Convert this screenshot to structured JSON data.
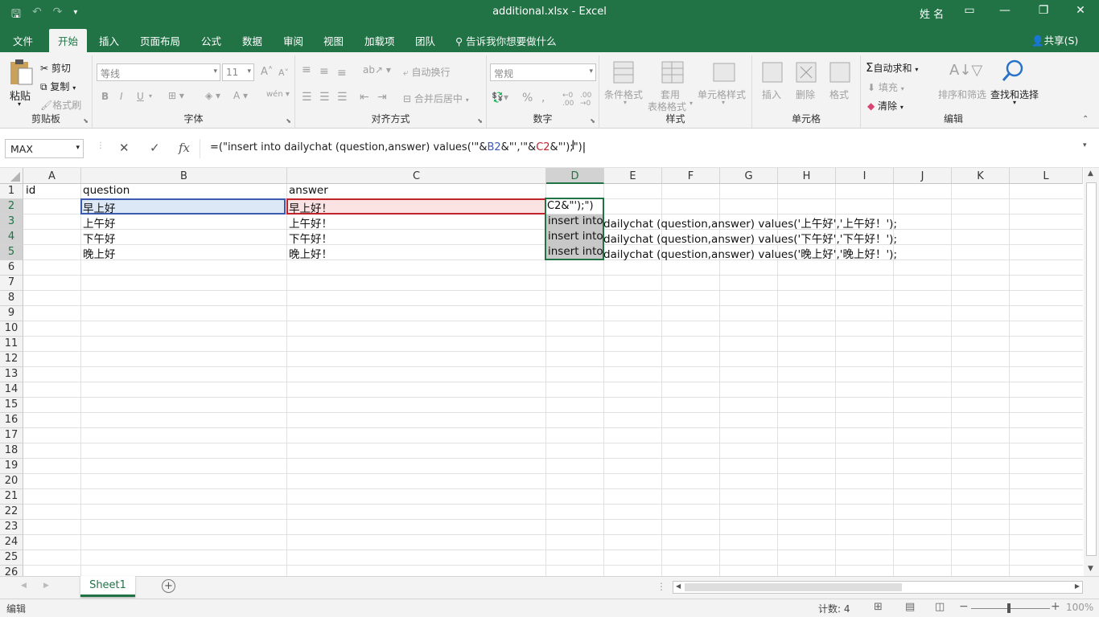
{
  "titlebar": {
    "title": "additional.xlsx  -  Excel",
    "user": "姓 名"
  },
  "tabs": [
    "文件",
    "开始",
    "插入",
    "页面布局",
    "公式",
    "数据",
    "审阅",
    "视图",
    "加载项",
    "团队"
  ],
  "tellme": "告诉我你想要做什么",
  "share": "共享(S)",
  "ribbon": {
    "clipboard": {
      "paste": "粘贴",
      "cut": "剪切",
      "copy": "复制",
      "painter": "格式刷",
      "label": "剪贴板"
    },
    "font": {
      "name": "等线",
      "size": "11",
      "label": "字体",
      "bold": "B",
      "italic": "I",
      "underline": "U"
    },
    "align": {
      "wrap": "自动换行",
      "merge": "合并后居中",
      "label": "对齐方式"
    },
    "number": {
      "format": "常规",
      "label": "数字"
    },
    "styles": {
      "cond": "条件格式",
      "table1": "套用",
      "table2": "表格格式",
      "cellstyle": "单元格样式",
      "label": "样式"
    },
    "cells": {
      "insert": "插入",
      "delete": "删除",
      "format": "格式",
      "label": "单元格"
    },
    "editing": {
      "autosum": "自动求和",
      "fill": "填充",
      "clear": "清除",
      "sort": "排序和筛选",
      "find": "查找和选择",
      "label": "编辑"
    }
  },
  "formula": {
    "namebox": "MAX",
    "p1": "=(\"insert into dailychat (question,answer) values('\"&",
    "ref1": "B2",
    "p2": "&\"','\"&",
    "ref2": "C2",
    "p3": "&\"');\")"
  },
  "columns": [
    "A",
    "B",
    "C",
    "D",
    "E",
    "F",
    "G",
    "H",
    "I",
    "J",
    "K",
    "L"
  ],
  "rows": [
    "1",
    "2",
    "3",
    "4",
    "5",
    "6",
    "7",
    "8",
    "9",
    "10",
    "11",
    "12",
    "13",
    "14",
    "15",
    "16",
    "17",
    "18",
    "19",
    "20",
    "21",
    "22",
    "23",
    "24",
    "25",
    "26"
  ],
  "cells": {
    "a1": "id",
    "b1": "question",
    "c1": "answer",
    "b2": "早上好",
    "c2": "早上好！",
    "d2": "C2&\"');\")",
    "b3": "上午好",
    "c3": "上午好！",
    "d3": "insert into",
    "o3": "dailychat (question,answer) values('上午好','上午好！');",
    "b4": "下午好",
    "c4": "下午好！",
    "d4": "insert into",
    "o4": "dailychat (question,answer) values('下午好','下午好！');",
    "b5": "晚上好",
    "c5": "晚上好！",
    "d5": "insert into",
    "o5": "dailychat (question,answer) values('晚上好','晚上好！');"
  },
  "sheet": "Sheet1",
  "status": {
    "mode": "编辑",
    "count": "计数: 4",
    "zoom": "100%"
  }
}
